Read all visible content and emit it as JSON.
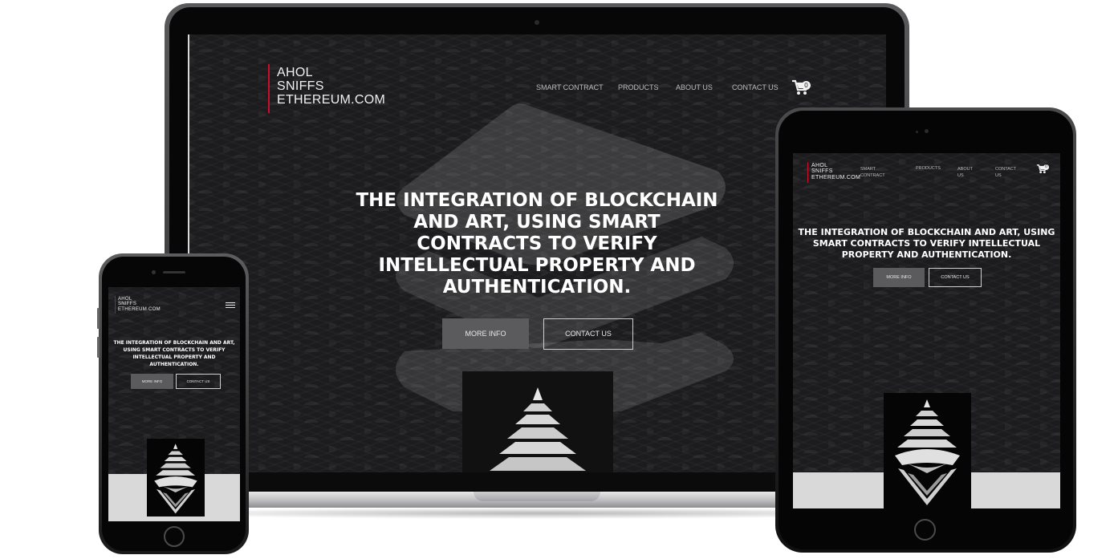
{
  "site": {
    "logo_line1": "AHOL",
    "logo_line2": "SNIFFS",
    "logo_line3": "ETHEREUM.COM",
    "nav": [
      "SMART CONTRACT",
      "PRODUCTS",
      "ABOUT US",
      "CONTACT US"
    ],
    "tablet_nav": {
      "smart_line1": "SMART",
      "smart_line2": "CONTRACT",
      "products": "PRODUCTS",
      "about_line1": "ABOUT",
      "about_line2": "US",
      "contact_line1": "CONTACT",
      "contact_line2": "US"
    },
    "cart_count": "0",
    "hero_laptop": [
      "THE INTEGRATION OF BLOCKCHAIN",
      "AND ART, USING SMART",
      "CONTRACTS TO VERIFY",
      "INTELLECTUAL PROPERTY AND",
      "AUTHENTICATION."
    ],
    "hero_tablet": [
      "THE INTEGRATION OF BLOCKCHAIN AND ART, USING",
      "SMART CONTRACTS TO VERIFY INTELLECTUAL",
      "PROPERTY AND AUTHENTICATION."
    ],
    "hero_phone": [
      "THE INTEGRATION OF BLOCKCHAIN AND ART,",
      "USING SMART CONTRACTS TO VERIFY",
      "INTELLECTUAL PROPERTY AND",
      "AUTHENTICATION."
    ],
    "more_info": "MORE INFO",
    "contact_us": "CONTACT US"
  },
  "icons": {
    "cart": "shopping-cart-icon",
    "menu": "hamburger-menu-icon",
    "artwork": "ethereum-pyramid-artwork"
  },
  "colors": {
    "logo_accent": "#c8102e",
    "background": "#1c1c1e",
    "button_fill": "#5b5b5d",
    "text": "#ffffff"
  }
}
